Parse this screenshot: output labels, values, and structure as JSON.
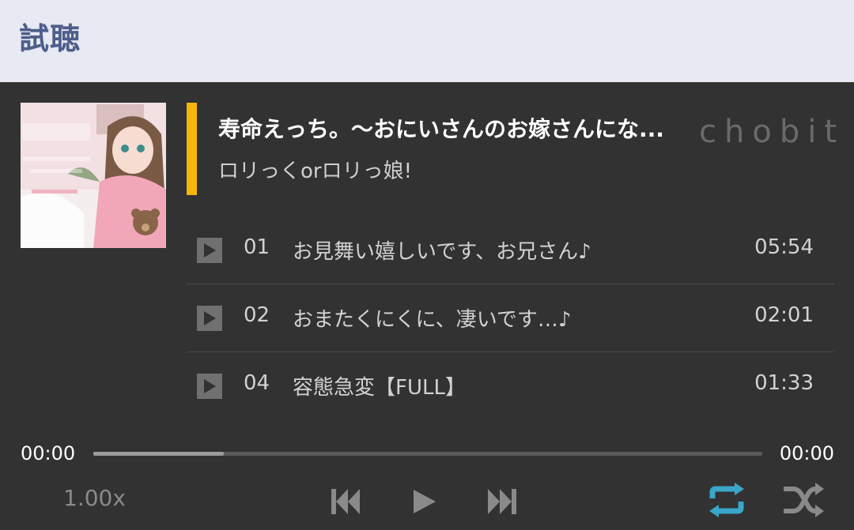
{
  "header": {
    "title": "試聴"
  },
  "work": {
    "title": "寿命えっち。〜おにいさんのお嫁さんにな...",
    "circle": "ロリっくorロリっ娘!",
    "watermark": "chobit",
    "cover_icon": "cover-art-image"
  },
  "tracks": [
    {
      "number": "01",
      "name": "お見舞い嬉しいです、お兄さん♪",
      "duration": "05:54"
    },
    {
      "number": "02",
      "name": "おまたくにくに、凄いです…♪",
      "duration": "02:01"
    },
    {
      "number": "04",
      "name": "容態急変【FULL】",
      "duration": "01:33"
    }
  ],
  "progress": {
    "current": "00:00",
    "total": "00:00",
    "buffered_fraction": 0.195
  },
  "controls": {
    "speed": "1.00x",
    "icons": [
      "skip-previous-icon",
      "play-icon",
      "skip-next-icon",
      "repeat-icon",
      "shuffle-icon"
    ],
    "repeat_active": true
  },
  "colors": {
    "header_bg": "#e7e9f3",
    "header_text": "#4d5e8a",
    "player_bg": "#323232",
    "accent": "#f6b40c",
    "repeat_active": "#3aa6c9",
    "control_inactive": "#8a8a8a"
  }
}
